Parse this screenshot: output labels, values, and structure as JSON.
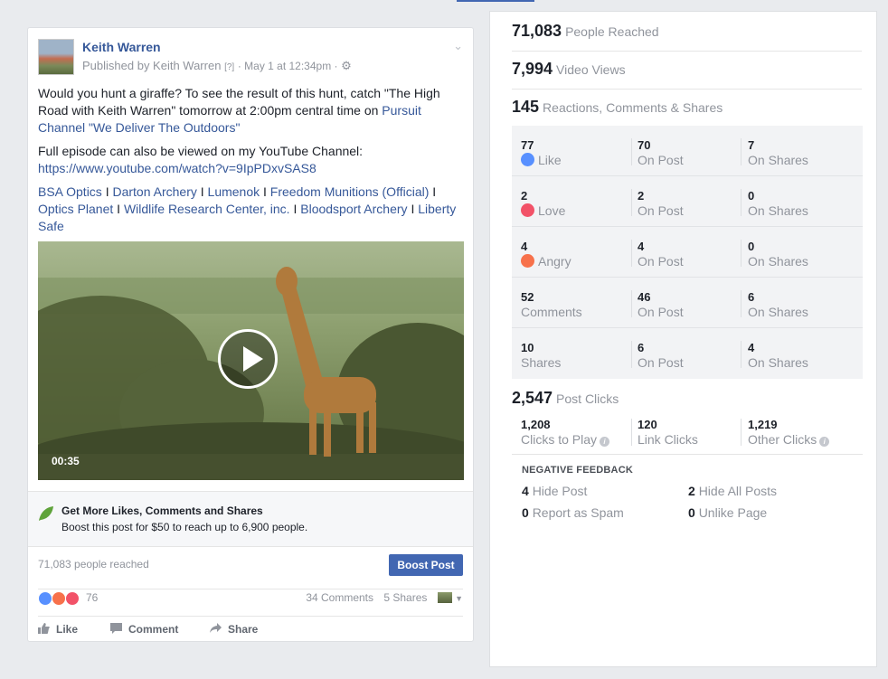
{
  "post": {
    "author": "Keith Warren",
    "published_by": "Published by Keith Warren",
    "help_tag": "[?]",
    "date": "· May 1 at 12:34pm ·",
    "text_line1": "Would you hunt a giraffe? To see the result of this hunt, catch \"The High Road with Keith Warren\" tomorrow at 2:00pm central time on ",
    "pursuit_link": "Pursuit Channel \"We Deliver The Outdoors\"",
    "text_line2": "Full episode can also be viewed on my YouTube Channel:",
    "youtube_link": "https://www.youtube.com/watch?v=9IpPDxvSAS8",
    "sponsors": [
      "BSA Optics",
      "Darton Archery",
      "Lumenok",
      "Freedom Munitions (Official)",
      "Optics Planet",
      "Wildlife Research Center, inc.",
      "Bloodsport Archery",
      "Liberty Safe"
    ],
    "sponsor_separator": "I",
    "video_duration": "00:35",
    "promo_title": "Get More Likes, Comments and Shares",
    "promo_subtitle": "Boost this post for $50 to reach up to 6,900 people.",
    "people_reached": "71,083 people reached",
    "boost_button": "Boost Post",
    "reaction_count": "76",
    "comments": "34 Comments",
    "shares": "5 Shares",
    "actions": {
      "like": "Like",
      "comment": "Comment",
      "share": "Share"
    }
  },
  "insights": {
    "people_reached": {
      "value": "71,083",
      "label": "People Reached"
    },
    "video_views": {
      "value": "7,994",
      "label": "Video Views"
    },
    "reactions_total": {
      "value": "145",
      "label": "Reactions, Comments & Shares"
    },
    "breakdown": [
      {
        "total": "77",
        "total_label": "Like",
        "on_post": "70",
        "on_post_label": "On Post",
        "on_shares": "7",
        "on_shares_label": "On Shares"
      },
      {
        "total": "2",
        "total_label": "Love",
        "on_post": "2",
        "on_post_label": "On Post",
        "on_shares": "0",
        "on_shares_label": "On Shares"
      },
      {
        "total": "4",
        "total_label": "Angry",
        "on_post": "4",
        "on_post_label": "On Post",
        "on_shares": "0",
        "on_shares_label": "On Shares"
      },
      {
        "total": "52",
        "total_label": "Comments",
        "on_post": "46",
        "on_post_label": "On Post",
        "on_shares": "6",
        "on_shares_label": "On Shares"
      },
      {
        "total": "10",
        "total_label": "Shares",
        "on_post": "6",
        "on_post_label": "On Post",
        "on_shares": "4",
        "on_shares_label": "On Shares"
      }
    ],
    "post_clicks": {
      "value": "2,547",
      "label": "Post Clicks"
    },
    "clicks": [
      {
        "value": "1,208",
        "label": "Clicks to Play"
      },
      {
        "value": "120",
        "label": "Link Clicks"
      },
      {
        "value": "1,219",
        "label": "Other Clicks"
      }
    ],
    "negative_title": "NEGATIVE FEEDBACK",
    "negative": [
      {
        "value": "4",
        "label": "Hide Post"
      },
      {
        "value": "2",
        "label": "Hide All Posts"
      },
      {
        "value": "0",
        "label": "Report as Spam"
      },
      {
        "value": "0",
        "label": "Unlike Page"
      }
    ]
  },
  "colors": {
    "link": "#365899",
    "boost": "#4267b2",
    "like": "#5890ff",
    "love": "#f25268",
    "angry": "#f7714b",
    "promo_leaf": "#5fa33b"
  }
}
